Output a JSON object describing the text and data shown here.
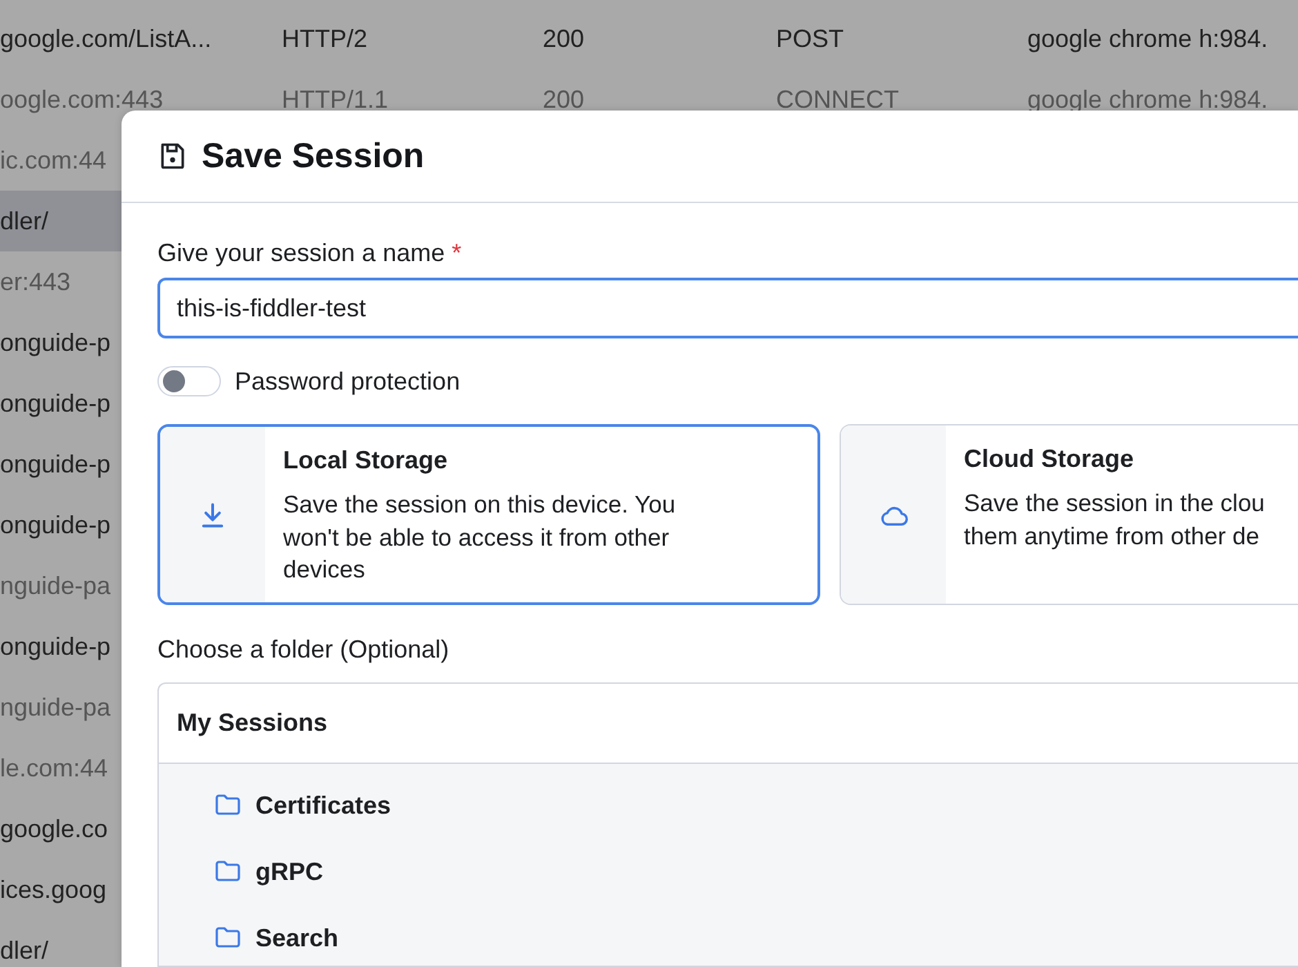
{
  "background_table": {
    "rows": [
      {
        "cells": [
          "google.com/ListA...",
          "HTTP/2",
          "200",
          "POST",
          "google chrome h:984."
        ],
        "dimmed": false,
        "selected": false
      },
      {
        "cells": [
          "oogle.com:443",
          "HTTP/1.1",
          "200",
          "CONNECT",
          "google chrome h:984."
        ],
        "dimmed": true,
        "selected": false
      },
      {
        "cells": [
          "ic.com:44"
        ],
        "dimmed": true,
        "selected": false
      },
      {
        "cells": [
          "dler/"
        ],
        "dimmed": false,
        "selected": true
      },
      {
        "cells": [
          "er:443"
        ],
        "dimmed": true,
        "selected": false
      },
      {
        "cells": [
          "onguide-p"
        ],
        "dimmed": false,
        "selected": false
      },
      {
        "cells": [
          "onguide-p"
        ],
        "dimmed": false,
        "selected": false
      },
      {
        "cells": [
          "onguide-p"
        ],
        "dimmed": false,
        "selected": false
      },
      {
        "cells": [
          "onguide-p"
        ],
        "dimmed": false,
        "selected": false
      },
      {
        "cells": [
          "nguide-pa"
        ],
        "dimmed": true,
        "selected": false
      },
      {
        "cells": [
          "onguide-p"
        ],
        "dimmed": false,
        "selected": false
      },
      {
        "cells": [
          "nguide-pa"
        ],
        "dimmed": true,
        "selected": false
      },
      {
        "cells": [
          "le.com:44"
        ],
        "dimmed": true,
        "selected": false
      },
      {
        "cells": [
          "google.co"
        ],
        "dimmed": false,
        "selected": false
      },
      {
        "cells": [
          "ices.goog"
        ],
        "dimmed": false,
        "selected": false
      },
      {
        "cells": [
          "dler/"
        ],
        "dimmed": false,
        "selected": false
      }
    ]
  },
  "dialog": {
    "title": "Save Session",
    "name_field": {
      "label": "Give your session a name",
      "required_mark": "*",
      "value": "this-is-fiddler-test"
    },
    "password_protection": {
      "label": "Password protection",
      "on": false
    },
    "storage_options": [
      {
        "kind": "local",
        "title": "Local Storage",
        "description": "Save the session on this device. You\nwon't be able to access it from other\ndevices",
        "selected": true
      },
      {
        "kind": "cloud",
        "title": "Cloud Storage",
        "description": "Save the session in the clou\nthem anytime from other de",
        "selected": false
      }
    ],
    "folder_label": "Choose a folder (Optional)",
    "folder_tree": {
      "root": "My Sessions",
      "children": [
        {
          "name": "Certificates"
        },
        {
          "name": "gRPC"
        },
        {
          "name": "Search"
        }
      ]
    }
  }
}
